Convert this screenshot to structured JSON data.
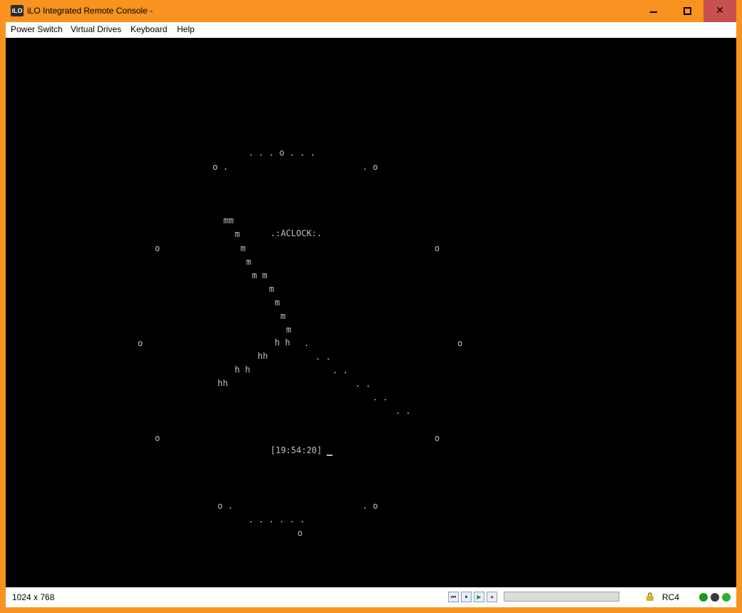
{
  "window": {
    "title": "iLO Integrated Remote Console -",
    "icon_text": "iLO",
    "close_glyph": "✕",
    "frame_color": "#F7931E"
  },
  "menu": [
    "Power Switch",
    "Virtual Drives",
    "Keyboard",
    "Help"
  ],
  "console": {
    "background": "#000000",
    "foreground": "#c0c0c0",
    "screen_text": [
      ". . . o . . .",
      "o .",
      ". o",
      "mm",
      "m",
      ".:ACLOCK:.",
      "o",
      "m",
      "o",
      "m",
      "m m",
      "m",
      "m",
      "m",
      "m",
      "o",
      "h h",
      ".",
      "o",
      "hh",
      ". .",
      "h h",
      ". .",
      "hh",
      ". .",
      ". .",
      ". .",
      "o",
      "o",
      "o .",
      ". o",
      ". . . . . .",
      "o"
    ],
    "clock_time": "[19:54:20]"
  },
  "status": {
    "resolution": "1024 x 768",
    "encryption": "RC4",
    "playback": [
      {
        "name": "rewind",
        "glyph": "⏮"
      },
      {
        "name": "pause",
        "glyph": "⏸"
      },
      {
        "name": "play",
        "glyph": "▶"
      },
      {
        "name": "record",
        "glyph": "●"
      }
    ],
    "progress": 0,
    "leds": [
      {
        "name": "power",
        "color": "#1a9a1a"
      },
      {
        "name": "health",
        "color": "#3a3a3a"
      },
      {
        "name": "activity",
        "color": "#2bb02b"
      }
    ]
  }
}
